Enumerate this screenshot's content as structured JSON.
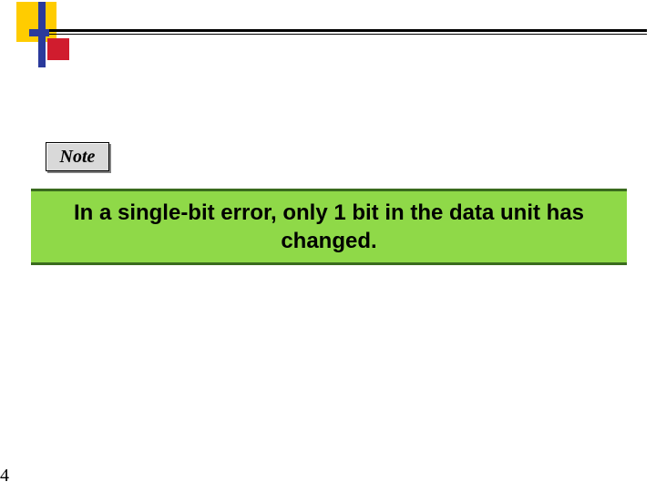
{
  "note": {
    "label": "Note"
  },
  "banner": {
    "text": "In a single-bit error, only 1 bit in the data unit has changed."
  },
  "page": {
    "number": "4"
  }
}
